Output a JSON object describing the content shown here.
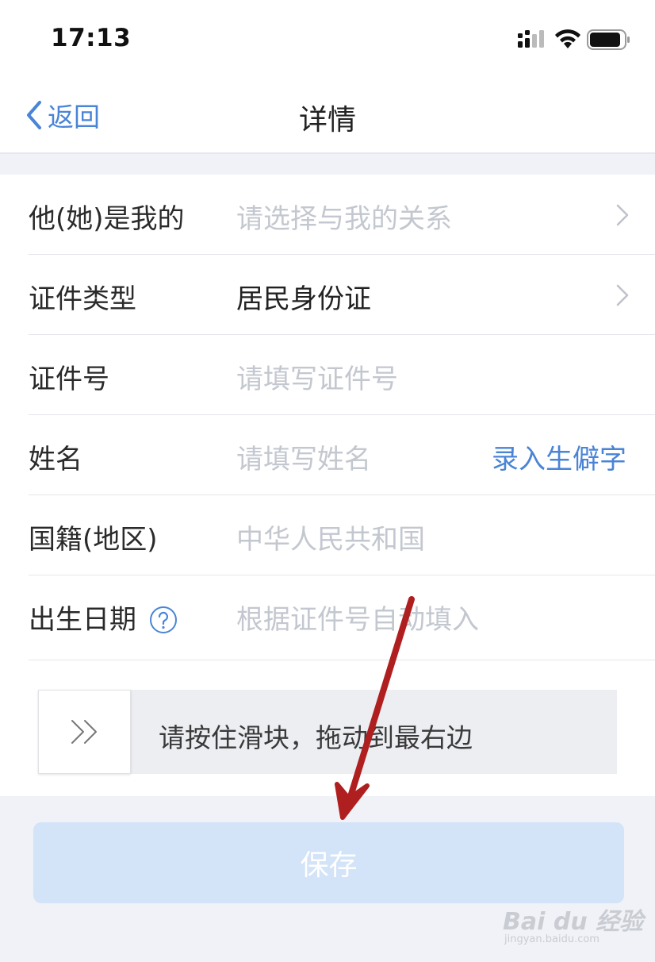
{
  "status_bar": {
    "time": "17:13"
  },
  "nav": {
    "back_label": "返回",
    "title": "详情"
  },
  "form": {
    "rows": [
      {
        "label": "他(她)是我的",
        "value": "请选择与我的关系",
        "is_placeholder": true,
        "has_chevron": true
      },
      {
        "label": "证件类型",
        "value": "居民身份证",
        "is_placeholder": false,
        "has_chevron": true
      },
      {
        "label": "证件号",
        "value": "请填写证件号",
        "is_placeholder": true
      },
      {
        "label": "姓名",
        "value": "请填写姓名",
        "is_placeholder": true,
        "action": "录入生僻字"
      },
      {
        "label": "国籍(地区)",
        "value": "中华人民共和国",
        "is_placeholder": true
      },
      {
        "label": "出生日期",
        "value": "根据证件号自动填入",
        "is_placeholder": true,
        "has_help_icon": true
      }
    ]
  },
  "slider": {
    "hint": "请按住滑块，拖动到最右边",
    "progress": 0
  },
  "save_button": {
    "label": "保存"
  },
  "watermark": {
    "text": "Bai du 经验",
    "sub": "jingyan.baidu.com"
  },
  "colors": {
    "accent": "#4a84d6",
    "placeholder": "#c3c7cf",
    "save_disabled_bg": "#d3e3f8",
    "annotation_arrow": "#b01f1f",
    "page_bg": "#f0f2f7"
  },
  "icons": [
    "signal-icon",
    "wifi-icon",
    "battery-icon",
    "back-chevron-icon",
    "chevron-right-icon",
    "help-icon",
    "double-chevron-icon",
    "annotation-arrow"
  ]
}
